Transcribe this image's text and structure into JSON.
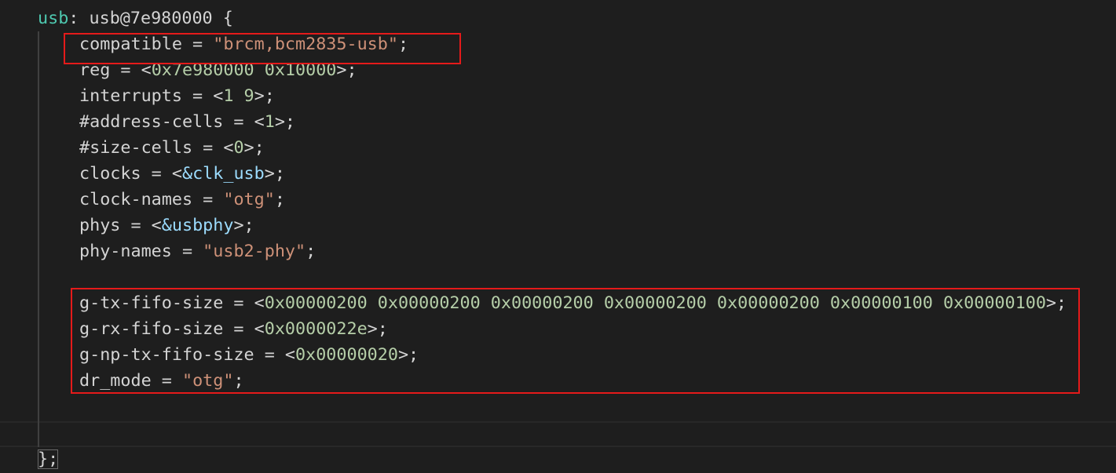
{
  "editor": {
    "theme": {
      "background": "#1e1e1e",
      "default_text": "#d4d4d4",
      "identifier": "#4ec9b0",
      "number": "#b5cea8",
      "string": "#ce9178",
      "reference": "#9cdcfe",
      "highlight_box": "#e51a1a"
    },
    "node": {
      "label": "usb",
      "colon": ": ",
      "name": "usb@7e980000",
      "open": " {",
      "close": "};"
    },
    "lines": {
      "compatible": {
        "key": "compatible",
        "op": " = ",
        "value": "\"brcm,bcm2835-usb\"",
        "end": ";"
      },
      "reg": {
        "key": "reg",
        "op": " = <",
        "value": "0x7e980000 0x10000",
        "end": ">;"
      },
      "interrupts": {
        "key": "interrupts",
        "op": " = <",
        "value": "1 9",
        "end": ">;"
      },
      "address_cells": {
        "key": "#address-cells",
        "op": " = <",
        "value": "1",
        "end": ">;"
      },
      "size_cells": {
        "key": "#size-cells",
        "op": " = <",
        "value": "0",
        "end": ">;"
      },
      "clocks": {
        "key": "clocks",
        "op": " = <",
        "value": "&clk_usb",
        "end": ">;"
      },
      "clock_names": {
        "key": "clock-names",
        "op": " = ",
        "value": "\"otg\"",
        "end": ";"
      },
      "phys": {
        "key": "phys",
        "op": " = <",
        "value": "&usbphy",
        "end": ">;"
      },
      "phy_names": {
        "key": "phy-names",
        "op": " = ",
        "value": "\"usb2-phy\"",
        "end": ";"
      },
      "g_tx_fifo_size": {
        "key": "g-tx-fifo-size",
        "op": " = <",
        "value": "0x00000200 0x00000200 0x00000200 0x00000200 0x00000200 0x00000100 0x00000100",
        "end": ">;"
      },
      "g_rx_fifo_size": {
        "key": "g-rx-fifo-size",
        "op": " = <",
        "value": "0x0000022e",
        "end": ">;"
      },
      "g_np_tx_fifo_size": {
        "key": "g-np-tx-fifo-size",
        "op": " = <",
        "value": "0x00000020",
        "end": ">;"
      },
      "dr_mode": {
        "key": "dr_mode",
        "op": " = ",
        "value": "\"otg\"",
        "end": ";"
      }
    }
  }
}
